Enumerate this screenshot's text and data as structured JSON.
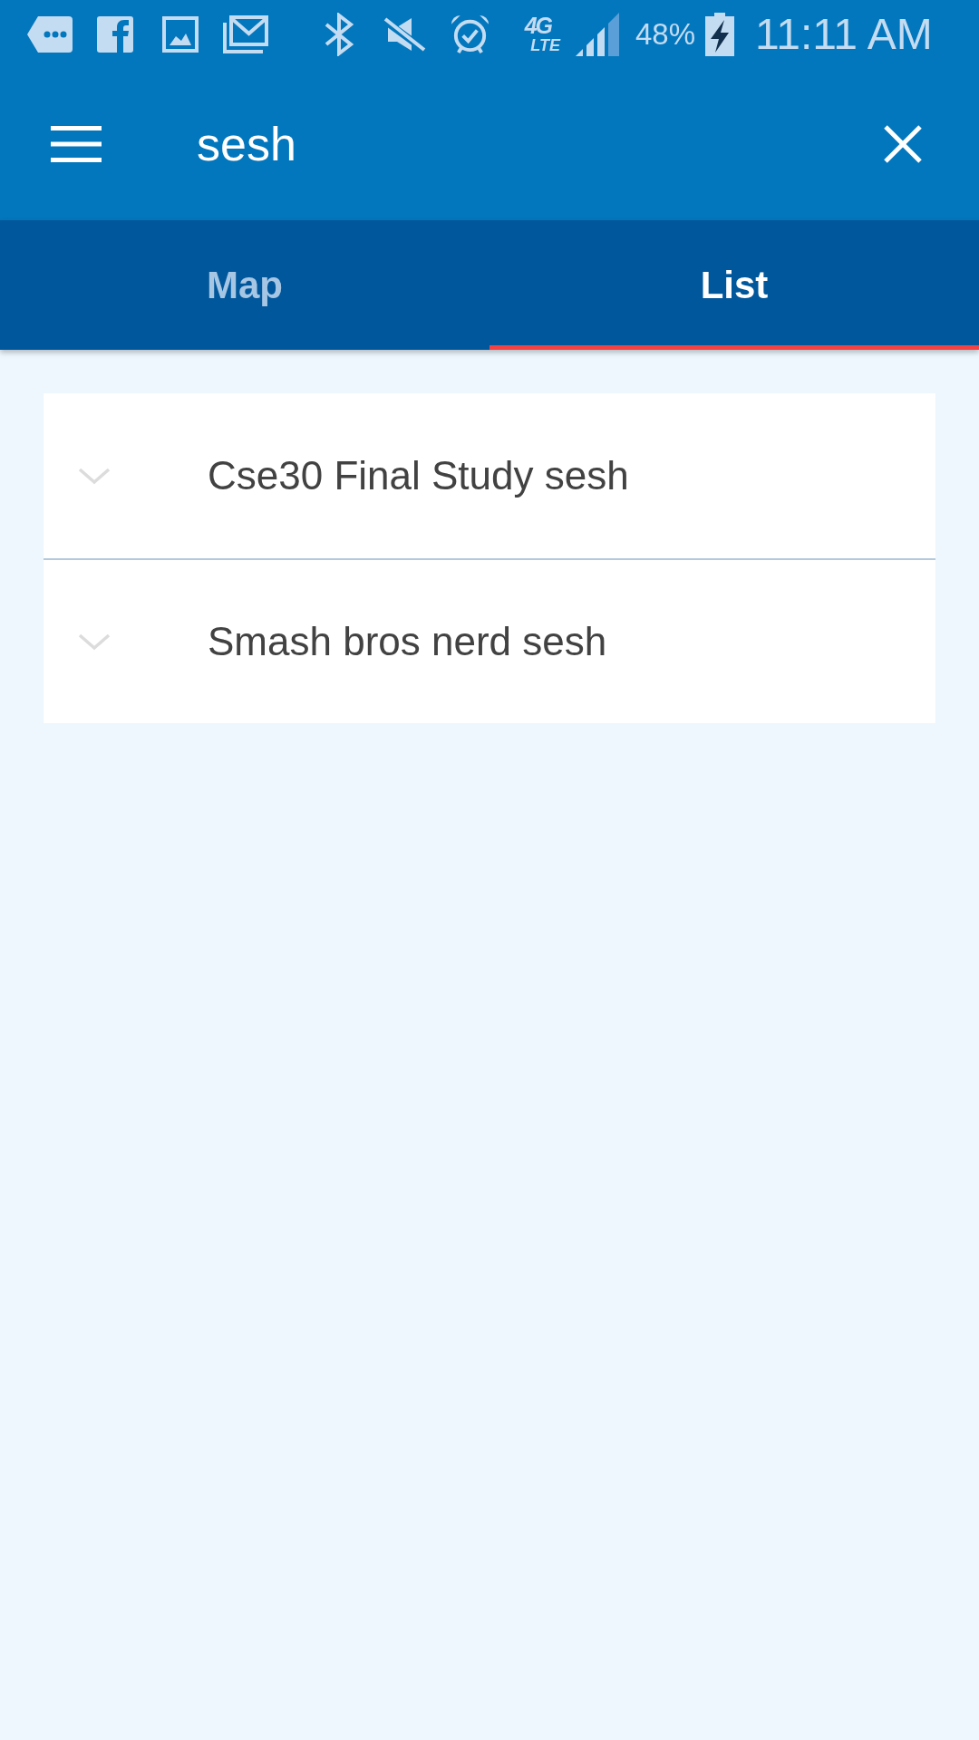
{
  "status_bar": {
    "network": {
      "generation": "4G",
      "type": "LTE"
    },
    "battery": "48%",
    "time": "11:11 AM"
  },
  "toolbar": {
    "search": {
      "value": "sesh"
    }
  },
  "tabs": [
    {
      "label": "Map",
      "selected": false
    },
    {
      "label": "List",
      "selected": true
    }
  ],
  "results": [
    {
      "title": "Cse30 Final Study sesh",
      "expanded": false
    },
    {
      "title": "Smash bros nerd sesh",
      "expanded": false
    }
  ]
}
